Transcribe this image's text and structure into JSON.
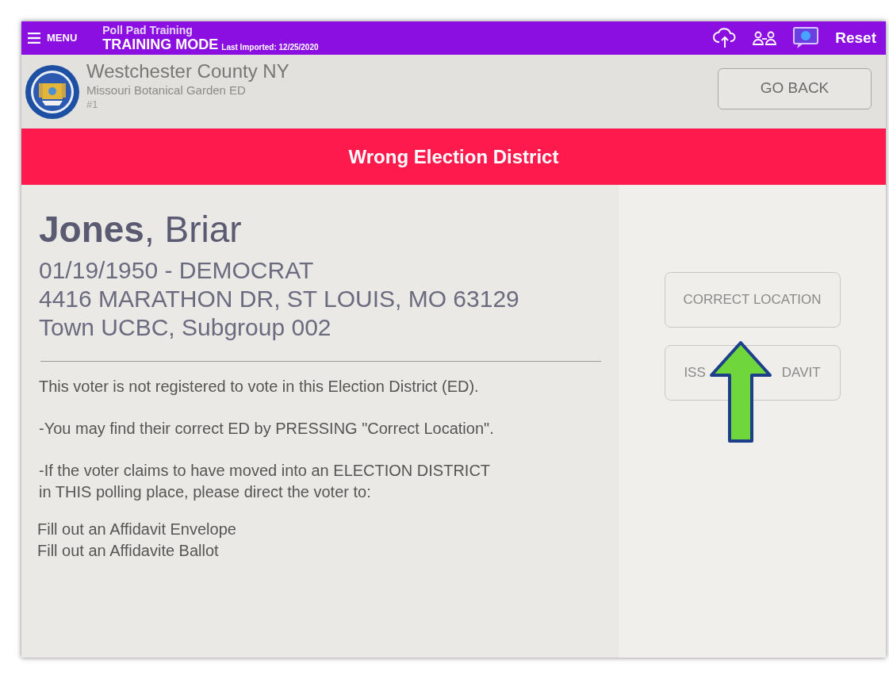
{
  "top_bar": {
    "menu_label": "MENU",
    "app_name": "Poll Pad Training",
    "mode": "TRAINING MODE",
    "last_imported": "Last Imported: 12/25/2020",
    "reset_label": "Reset"
  },
  "header": {
    "county": "Westchester County NY",
    "district": "Missouri Botanical Garden ED",
    "number": "#1",
    "back_button": "GO BACK"
  },
  "banner": "Wrong Election District",
  "voter": {
    "last_name": "Jones",
    "first_name": ", Briar",
    "birth_party": "01/19/1950 - DEMOCRAT",
    "address": "4416 MARATHON DR, ST LOUIS, MO 63129",
    "town": "Town UCBC, Subgroup 002"
  },
  "messages": [
    "This voter is not registered to vote in this Election District (ED).",
    "-You may find their correct ED by PRESSING \"Correct Location\".",
    "-If the voter claims to have moved into an ELECTION DISTRICT\nin THIS polling place, please direct the voter to:"
  ],
  "instructions": [
    "Fill out an Affidavit Envelope",
    "Fill out an Affidavite Ballot"
  ],
  "actions": [
    {
      "label_parts": [
        "CORRECT LOCATION"
      ]
    },
    {
      "label_parts": [
        "ISS",
        "DAVIT"
      ]
    }
  ]
}
